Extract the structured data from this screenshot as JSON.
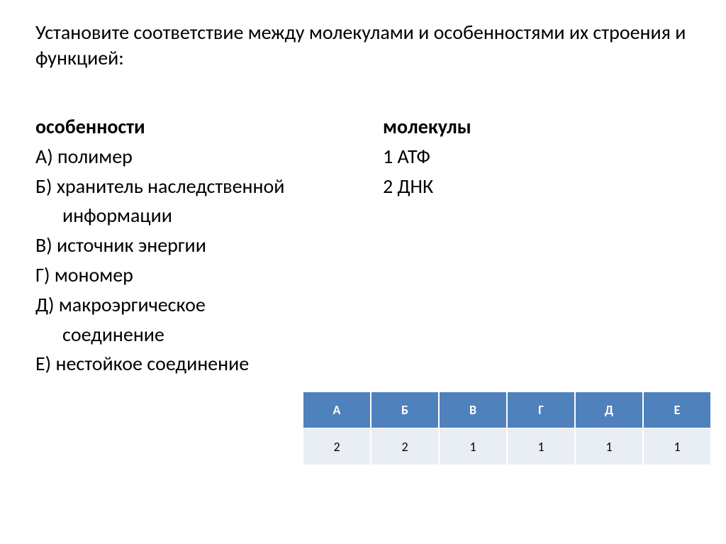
{
  "title": "Установите соответствие между молекулами и особенностями  их строения и функцией:",
  "left": {
    "header": "особенности",
    "items": [
      {
        "label": "А) полимер"
      },
      {
        "label": "Б) хранитель наследственной",
        "cont": "информации"
      },
      {
        "label": "В) источник энергии"
      },
      {
        "label": "Г) мономер"
      },
      {
        "label": "Д) макроэргическое",
        "cont": "соединение"
      },
      {
        "label": "Е) нестойкое соединение"
      }
    ]
  },
  "right": {
    "header": "молекулы",
    "items": [
      {
        "label": "1 АТФ"
      },
      {
        "label": " 2 ДНК"
      }
    ]
  },
  "answers": {
    "headers": [
      "А",
      "Б",
      "В",
      "Г",
      "Д",
      "Е"
    ],
    "values": [
      "2",
      "2",
      "1",
      "1",
      "1",
      "1"
    ]
  }
}
